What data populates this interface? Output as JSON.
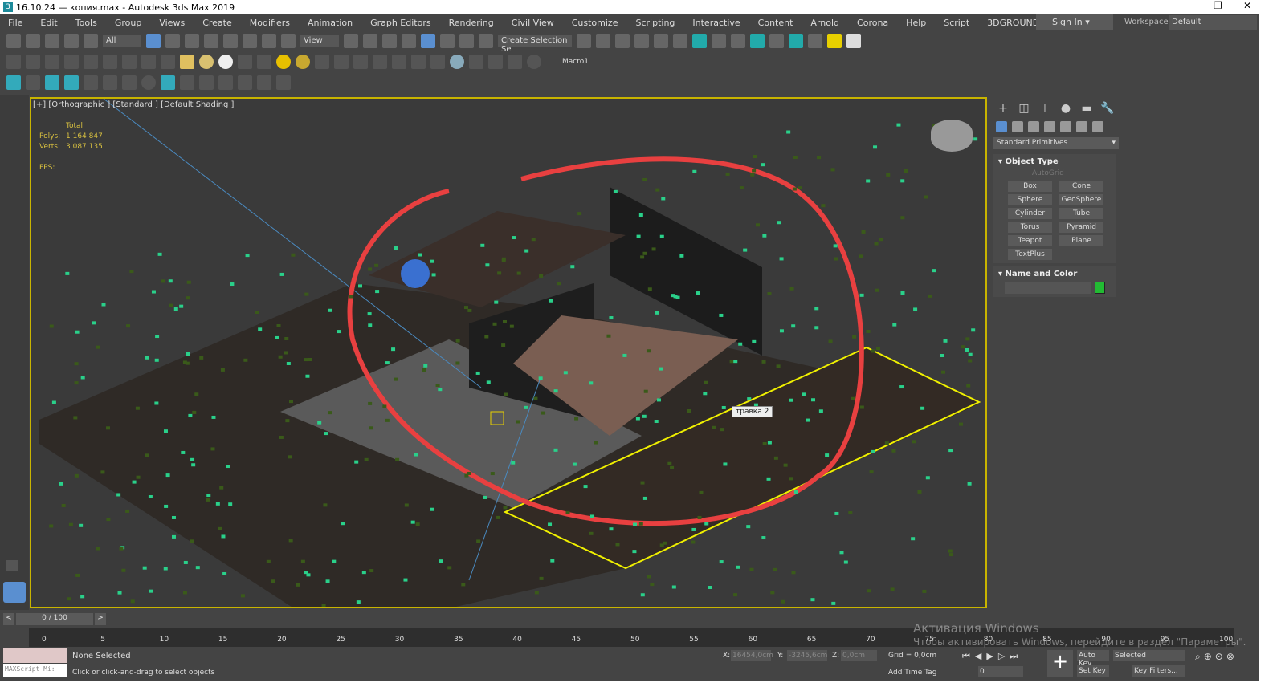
{
  "title": "16.10.24 — копия.max - Autodesk 3ds Max 2019",
  "window_controls": [
    "–",
    "❐",
    "✕"
  ],
  "menu": [
    "File",
    "Edit",
    "Tools",
    "Group",
    "Views",
    "Create",
    "Modifiers",
    "Animation",
    "Graph Editors",
    "Rendering",
    "Civil View",
    "Customize",
    "Scripting",
    "Interactive",
    "Content",
    "Arnold",
    "Corona",
    "Help",
    "Script",
    "3DGROUND"
  ],
  "signin": "Sign In",
  "workspaces_label": "Workspaces:",
  "workspace": "Default",
  "toolbar": {
    "filter": "All",
    "ref_coord": "View",
    "selection_set": "Create Selection Se",
    "macro": "Macro1"
  },
  "viewport": {
    "label": "[+] [Orthographic ] [Standard ] [Default Shading ]",
    "stats_total": "Total",
    "polys_label": "Polys:",
    "polys": "1 164 847",
    "verts_label": "Verts:",
    "verts": "3 087 135",
    "fps_label": "FPS:",
    "tooltip": "травка 2"
  },
  "command_panel": {
    "category": "Standard Primitives",
    "object_type": "Object Type",
    "autogrid": "AutoGrid",
    "buttons": [
      "Box",
      "Cone",
      "Sphere",
      "GeoSphere",
      "Cylinder",
      "Tube",
      "Torus",
      "Pyramid",
      "Teapot",
      "Plane",
      "TextPlus"
    ],
    "name_and_color": "Name and Color",
    "color": "#22bb33"
  },
  "timeline": {
    "frame": "0 / 100",
    "ticks": [
      "0",
      "5",
      "10",
      "15",
      "20",
      "25",
      "30",
      "35",
      "40",
      "45",
      "50",
      "55",
      "60",
      "65",
      "70",
      "75",
      "80",
      "85",
      "90",
      "95",
      "100"
    ]
  },
  "status": {
    "selection": "None Selected",
    "prompt": "Click or click-and-drag to select objects",
    "maxscript": "MAXScript Mi:",
    "x_label": "X:",
    "x": "16454,0cm",
    "y_label": "Y:",
    "y": "-3245,6cm",
    "z_label": "Z:",
    "z": "0,0cm",
    "grid": "Grid = 0,0cm",
    "add_time_tag": "Add Time Tag",
    "auto_key": "Auto Key",
    "set_key": "Set Key",
    "key_mode": "Selected",
    "key_filters": "Key Filters...",
    "frame_field": "0"
  },
  "watermark": {
    "title": "Активация Windows",
    "text": "Чтобы активировать Windows, перейдите в раздел \"Параметры\"."
  }
}
